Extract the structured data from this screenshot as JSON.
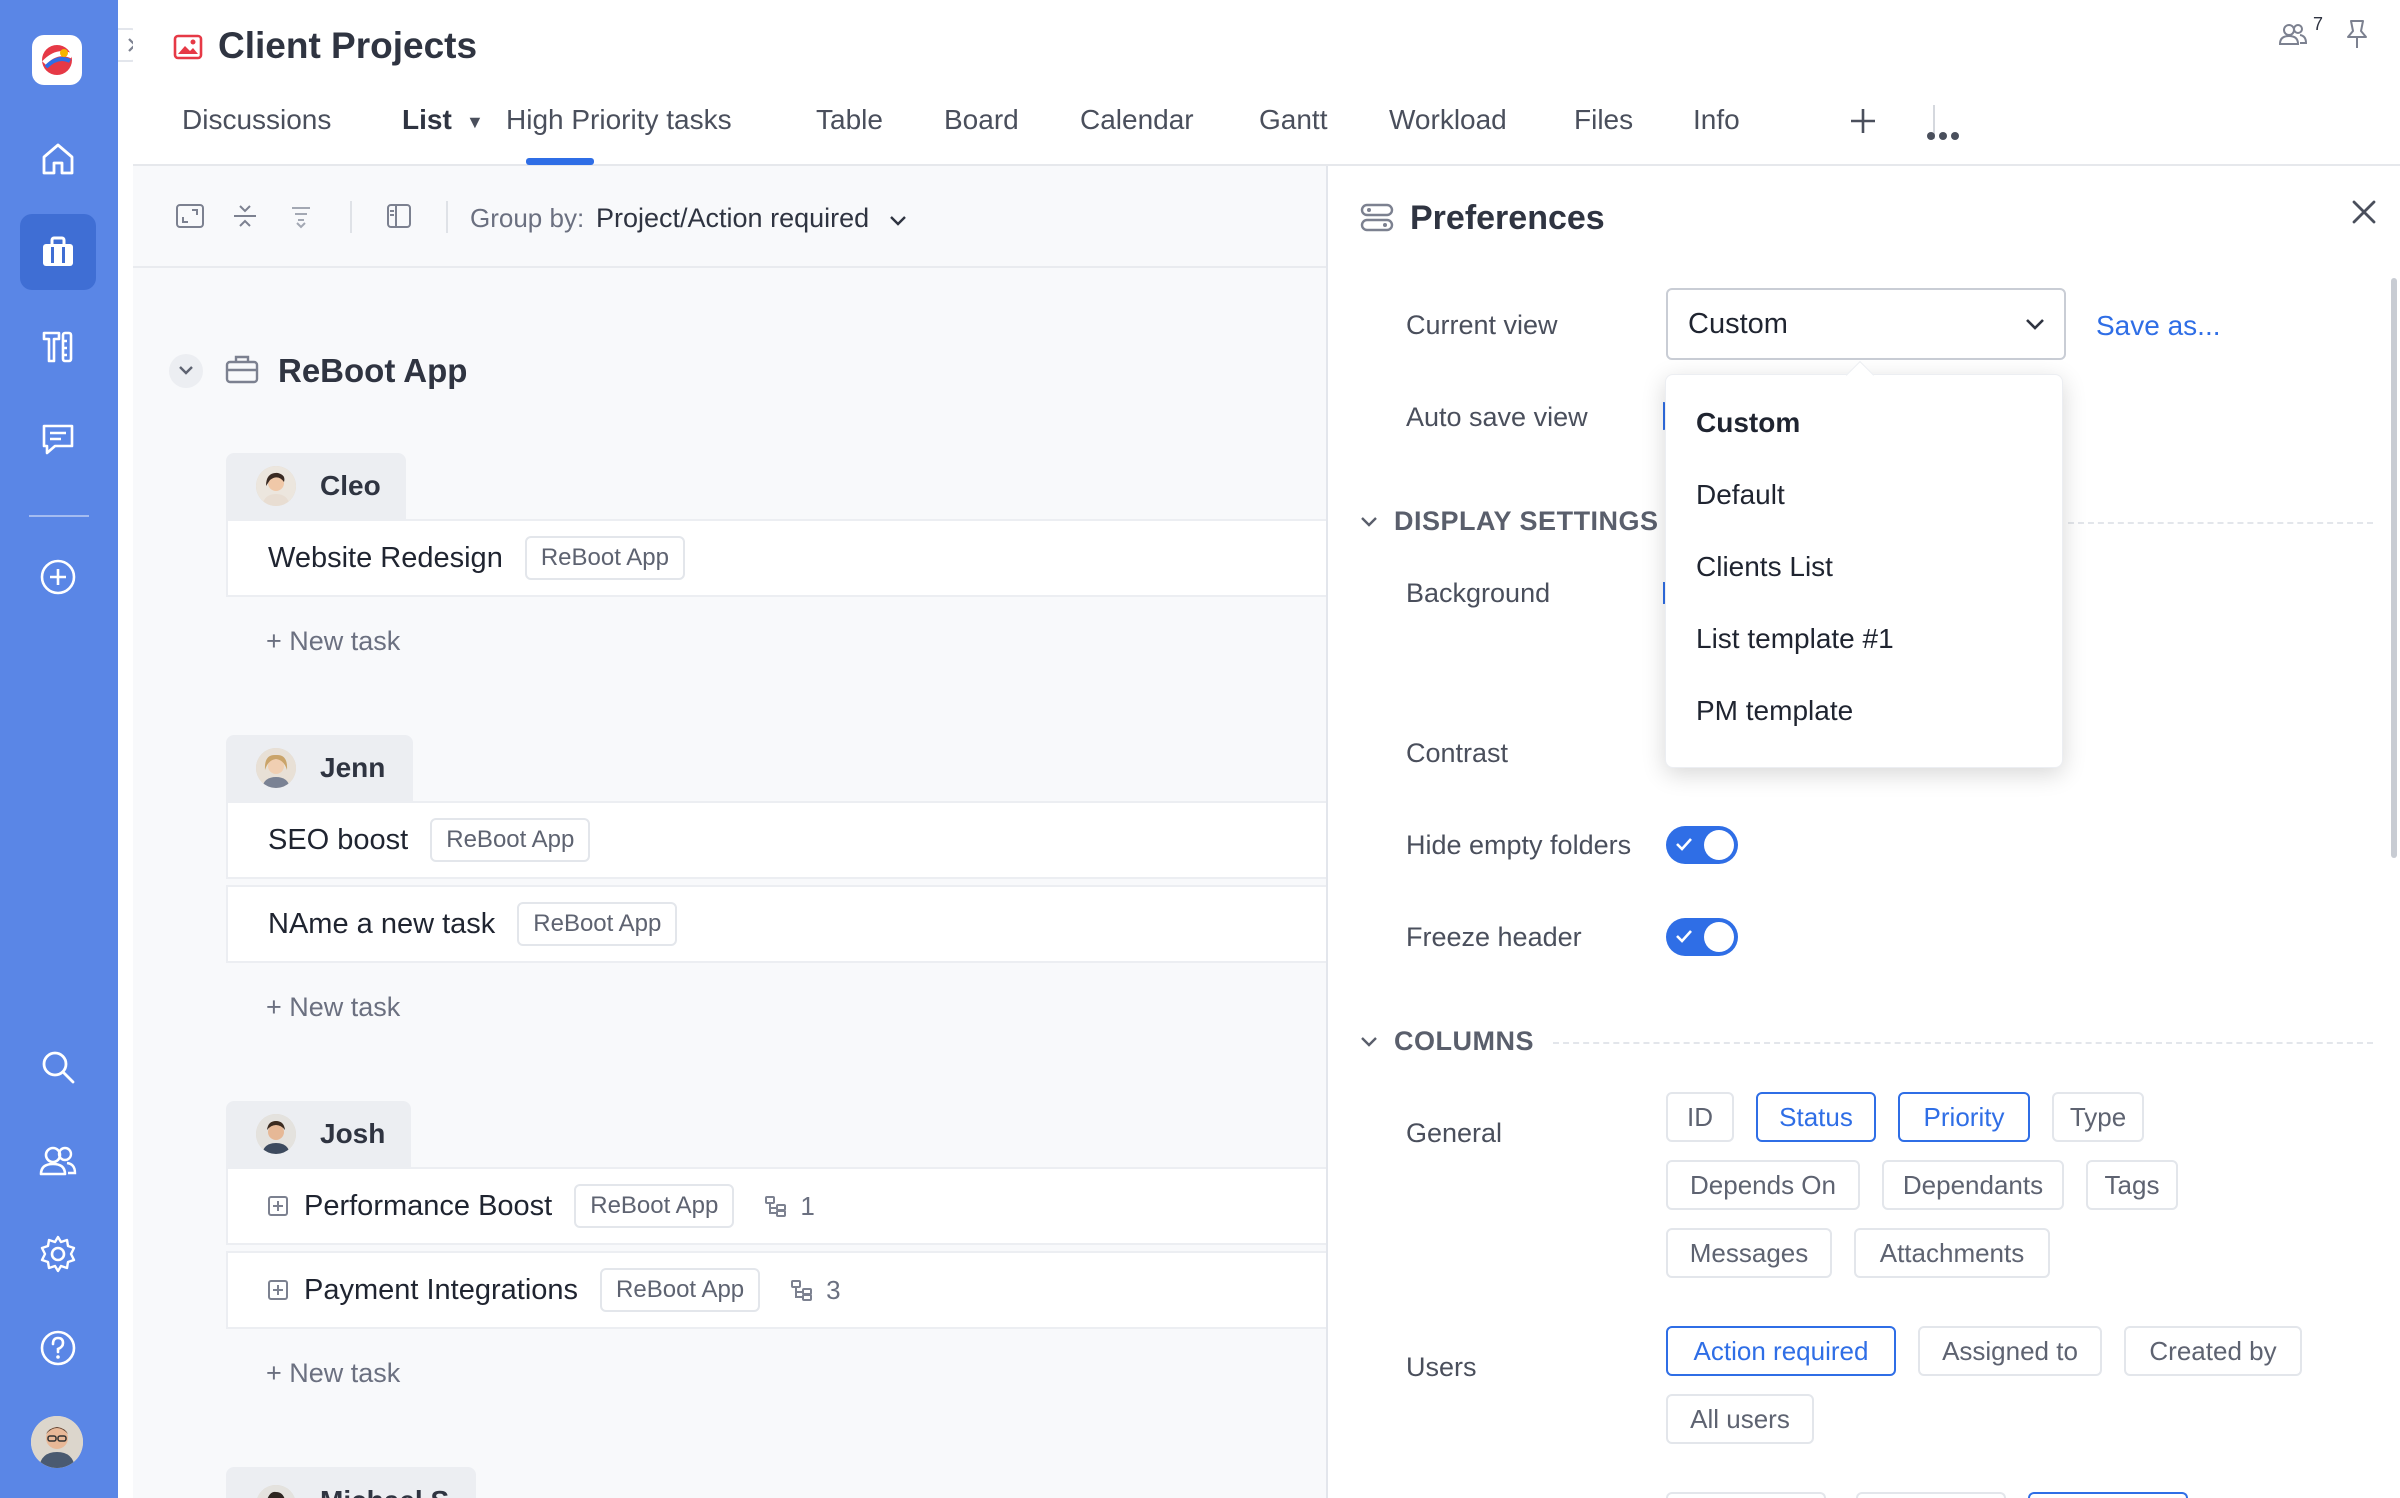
{
  "project": {
    "title": "Client Projects",
    "users_count": "7"
  },
  "tabs": [
    {
      "label": "Discussions"
    },
    {
      "label": "List"
    },
    {
      "label": "High Priority tasks"
    },
    {
      "label": "Table"
    },
    {
      "label": "Board"
    },
    {
      "label": "Calendar"
    },
    {
      "label": "Gantt"
    },
    {
      "label": "Workload"
    },
    {
      "label": "Files"
    },
    {
      "label": "Info"
    }
  ],
  "toolbar": {
    "group_by_label": "Group by:",
    "group_by_value": "Project/Action required"
  },
  "group": {
    "title": "ReBoot App"
  },
  "users": [
    {
      "name": "Cleo",
      "tasks": [
        {
          "name": "Website Redesign",
          "tag": "ReBoot App"
        }
      ]
    },
    {
      "name": "Jenn",
      "tasks": [
        {
          "name": "SEO boost",
          "tag": "ReBoot App"
        },
        {
          "name": "NAme a new task",
          "tag": "ReBoot App"
        }
      ]
    },
    {
      "name": "Josh",
      "tasks": [
        {
          "name": "Performance Boost",
          "tag": "ReBoot App",
          "subtasks": "1"
        },
        {
          "name": "Payment Integrations",
          "tag": "ReBoot App",
          "subtasks": "3"
        }
      ]
    },
    {
      "name": "Michael S"
    }
  ],
  "new_task_label": "+ New task",
  "preferences": {
    "title": "Preferences",
    "current_view_label": "Current view",
    "current_view_value": "Custom",
    "save_as": "Save as...",
    "auto_save_label": "Auto save view",
    "display_settings": "DISPLAY SETTINGS",
    "background_label": "Background",
    "contrast_label": "Contrast",
    "hide_empty_label": "Hide empty folders",
    "freeze_header_label": "Freeze header",
    "hide_empty_on": true,
    "freeze_header_on": true,
    "columns": "COLUMNS",
    "general_label": "General",
    "general_chips": [
      {
        "label": "ID",
        "selected": false
      },
      {
        "label": "Status",
        "selected": true
      },
      {
        "label": "Priority",
        "selected": true
      },
      {
        "label": "Type",
        "selected": false
      },
      {
        "label": "Depends On",
        "selected": false
      },
      {
        "label": "Dependants",
        "selected": false
      },
      {
        "label": "Tags",
        "selected": false
      },
      {
        "label": "Messages",
        "selected": false
      },
      {
        "label": "Attachments",
        "selected": false
      }
    ],
    "users_label": "Users",
    "users_chips": [
      {
        "label": "Action required",
        "selected": true
      },
      {
        "label": "Assigned to",
        "selected": false
      },
      {
        "label": "Created by",
        "selected": false
      },
      {
        "label": "All users",
        "selected": false
      }
    ]
  },
  "view_dropdown": {
    "options": [
      "Custom",
      "Default",
      "Clients List",
      "List template #1",
      "PM template"
    ],
    "selected": "Custom"
  },
  "colors": {
    "sidebar": "#5a86e6",
    "accent": "#2f6ee6",
    "logo_red": "#e63946"
  }
}
